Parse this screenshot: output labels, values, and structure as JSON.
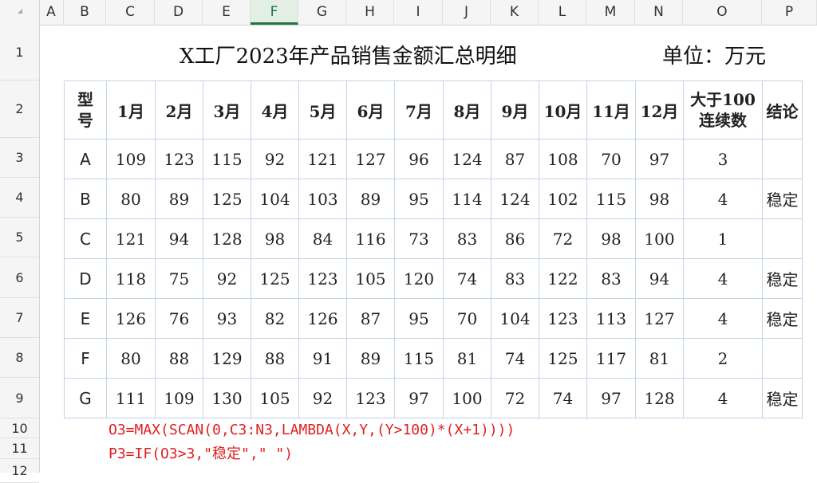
{
  "columns": [
    "A",
    "B",
    "C",
    "D",
    "E",
    "F",
    "G",
    "H",
    "I",
    "J",
    "K",
    "L",
    "M",
    "N",
    "O",
    "P"
  ],
  "selected_column": "F",
  "rows": [
    "1",
    "2",
    "3",
    "4",
    "5",
    "6",
    "7",
    "8",
    "9",
    "10",
    "11",
    "12"
  ],
  "title": "X工厂2023年产品销售金额汇总明细",
  "unit": "单位：万元",
  "header": {
    "model": "型号",
    "months": [
      "1月",
      "2月",
      "3月",
      "4月",
      "5月",
      "6月",
      "7月",
      "8月",
      "9月",
      "10月",
      "11月",
      "12月"
    ],
    "streak_line1": "大于100",
    "streak_line2": "连续数",
    "conclusion": "结论"
  },
  "table": [
    {
      "model": "A",
      "values": [
        "109",
        "123",
        "115",
        "92",
        "121",
        "127",
        "96",
        "124",
        "87",
        "108",
        "70",
        "97"
      ],
      "streak": "3",
      "conclusion": ""
    },
    {
      "model": "B",
      "values": [
        "80",
        "89",
        "125",
        "104",
        "103",
        "89",
        "95",
        "114",
        "124",
        "102",
        "115",
        "98"
      ],
      "streak": "4",
      "conclusion": "稳定"
    },
    {
      "model": "C",
      "values": [
        "121",
        "94",
        "128",
        "98",
        "84",
        "116",
        "73",
        "83",
        "86",
        "72",
        "98",
        "100"
      ],
      "streak": "1",
      "conclusion": ""
    },
    {
      "model": "D",
      "values": [
        "118",
        "75",
        "92",
        "125",
        "123",
        "105",
        "120",
        "74",
        "83",
        "122",
        "83",
        "94"
      ],
      "streak": "4",
      "conclusion": "稳定"
    },
    {
      "model": "E",
      "values": [
        "126",
        "76",
        "93",
        "82",
        "126",
        "87",
        "95",
        "70",
        "104",
        "123",
        "113",
        "127"
      ],
      "streak": "4",
      "conclusion": "稳定"
    },
    {
      "model": "F",
      "values": [
        "80",
        "88",
        "129",
        "88",
        "91",
        "89",
        "115",
        "81",
        "74",
        "125",
        "117",
        "81"
      ],
      "streak": "2",
      "conclusion": ""
    },
    {
      "model": "G",
      "values": [
        "111",
        "109",
        "130",
        "105",
        "92",
        "123",
        "97",
        "100",
        "72",
        "74",
        "97",
        "128"
      ],
      "streak": "4",
      "conclusion": "稳定"
    }
  ],
  "formulas": [
    "O3=MAX(SCAN(0,C3:N3,LAMBDA(X,Y,(Y>100)*(X+1))))",
    "P3=IF(O3>3,\"稳定\",\" \")"
  ],
  "colors": {
    "formula": "#e02020",
    "grid_border": "#c5d3e8",
    "selected": "#217346"
  }
}
